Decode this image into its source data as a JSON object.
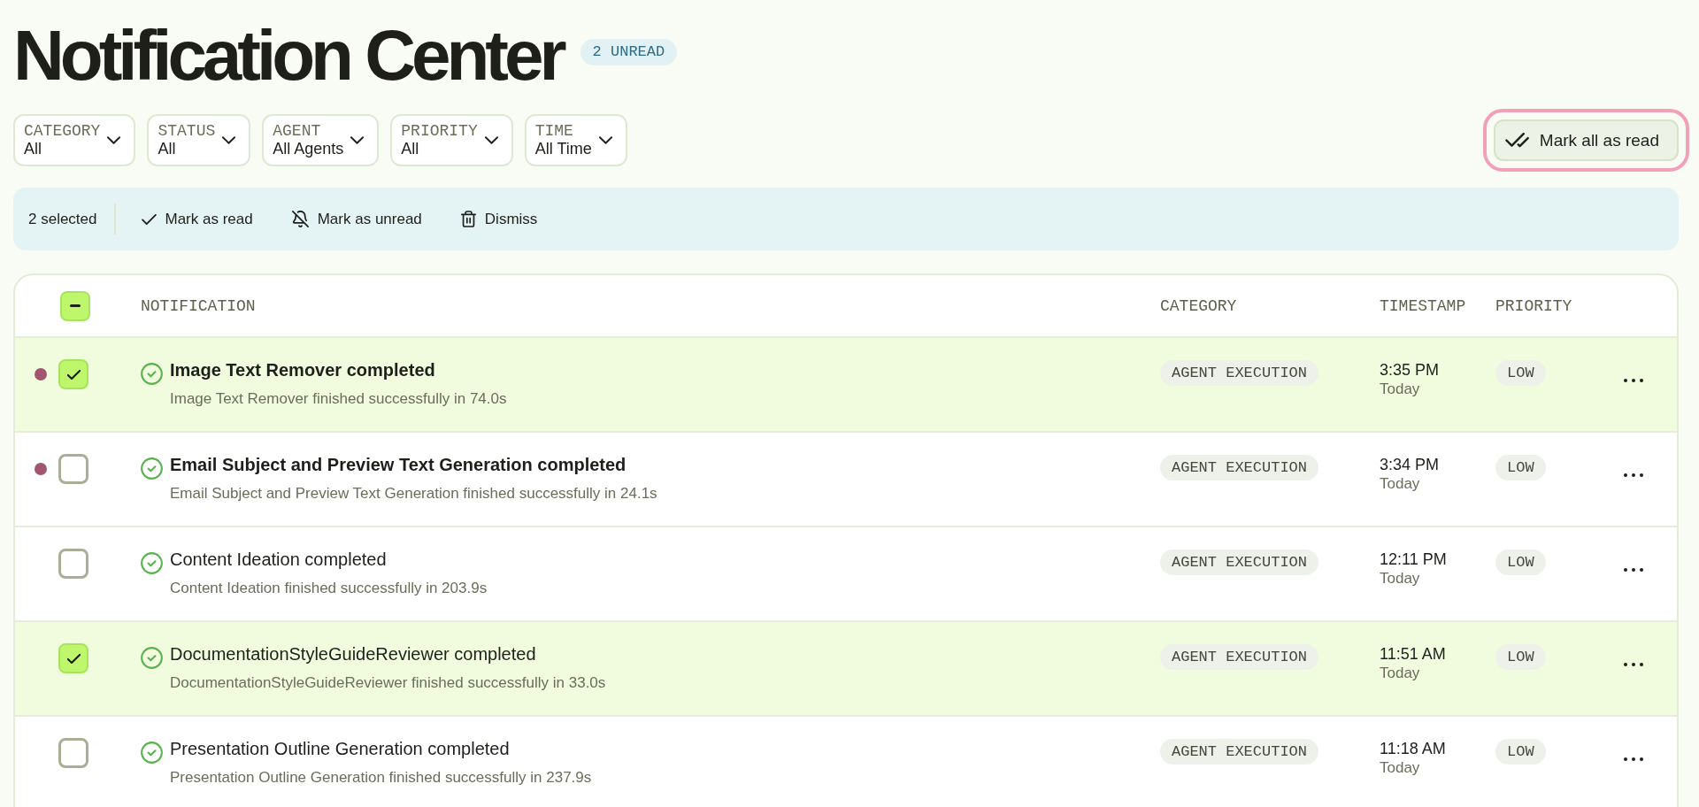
{
  "header": {
    "title": "Notification Center",
    "unread_badge": "2 UNREAD"
  },
  "filters": [
    {
      "label": "CATEGORY",
      "value": "All"
    },
    {
      "label": "STATUS",
      "value": "All"
    },
    {
      "label": "AGENT",
      "value": "All Agents"
    },
    {
      "label": "PRIORITY",
      "value": "All"
    },
    {
      "label": "TIME",
      "value": "All Time"
    }
  ],
  "mark_all": {
    "label": "Mark all as read",
    "focused": true
  },
  "bulk_bar": {
    "count": "2 selected",
    "actions": [
      {
        "kind": "read",
        "label": "Mark as read"
      },
      {
        "kind": "unread",
        "label": "Mark as unread"
      },
      {
        "kind": "dismiss",
        "label": "Dismiss"
      }
    ]
  },
  "table": {
    "select_all": {
      "indeterminate": true
    },
    "columns": [
      "NOTIFICATION",
      "CATEGORY",
      "TIMESTAMP",
      "PRIORITY"
    ],
    "rows": [
      {
        "unread": true,
        "selected": true,
        "title": "Image Text Remover completed",
        "description": "Image Text Remover finished successfully in 74.0s",
        "category": "AGENT EXECUTION",
        "time": "3:35 PM",
        "date": "Today",
        "priority": "LOW"
      },
      {
        "unread": true,
        "selected": false,
        "title": "Email Subject and Preview Text Generation completed",
        "description": "Email Subject and Preview Text Generation finished successfully in 24.1s",
        "category": "AGENT EXECUTION",
        "time": "3:34 PM",
        "date": "Today",
        "priority": "LOW"
      },
      {
        "unread": false,
        "selected": false,
        "title": "Content Ideation completed",
        "description": "Content Ideation finished successfully in 203.9s",
        "category": "AGENT EXECUTION",
        "time": "12:11 PM",
        "date": "Today",
        "priority": "LOW"
      },
      {
        "unread": false,
        "selected": true,
        "title": "DocumentationStyleGuideReviewer completed",
        "description": "DocumentationStyleGuideReviewer finished successfully in 33.0s",
        "category": "AGENT EXECUTION",
        "time": "11:51 AM",
        "date": "Today",
        "priority": "LOW"
      },
      {
        "unread": false,
        "selected": false,
        "title": "Presentation Outline Generation completed",
        "description": "Presentation Outline Generation finished successfully in 237.9s",
        "category": "AGENT EXECUTION",
        "time": "11:18 AM",
        "date": "Today",
        "priority": "LOW"
      }
    ]
  }
}
